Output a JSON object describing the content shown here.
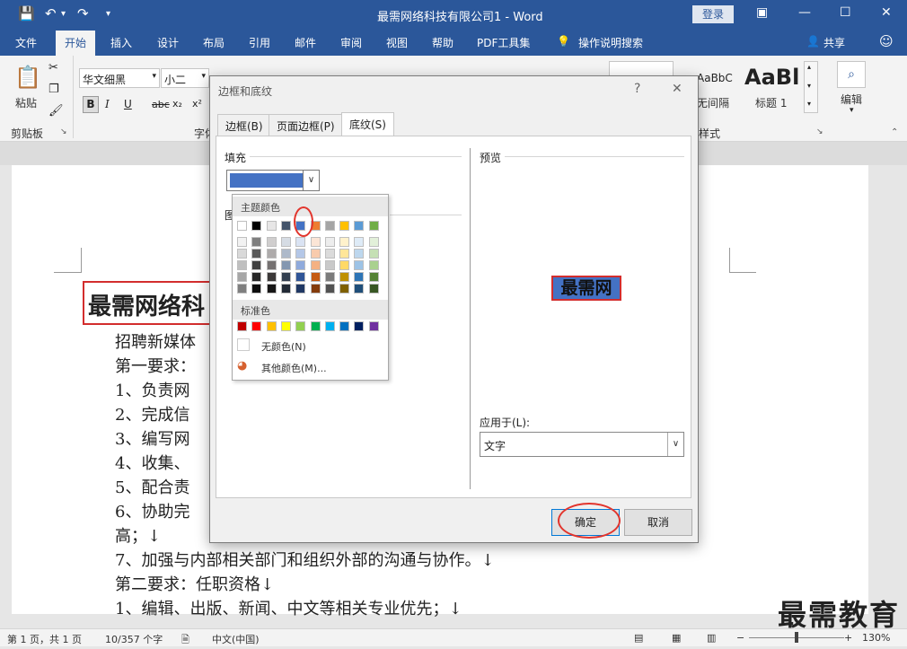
{
  "app": {
    "window_title": "最需网络科技有限公司1 - Word",
    "login_label": "登录"
  },
  "ribbon_tabs": [
    "文件",
    "开始",
    "插入",
    "设计",
    "布局",
    "引用",
    "邮件",
    "审阅",
    "视图",
    "帮助",
    "PDF工具集",
    "操作说明搜索"
  ],
  "ribbon": {
    "share_label": "共享",
    "paste_label": "粘贴",
    "clipboard_label": "剪贴板",
    "font_name": "华文细黑",
    "font_size": "小二",
    "font_group_label": "字体",
    "style_group_label": "样式",
    "style1_preview": "AaBbCcDc",
    "style1_label": "无间隔",
    "style2_preview": "AaBl",
    "style2_label": "标题 1",
    "edit_label": "编辑",
    "bold": "B",
    "italic": "I",
    "underline": "U",
    "strike": "abc",
    "subscript": "x₂",
    "superscript": "x²"
  },
  "document": {
    "title_visible": "最需网络科",
    "lines": [
      "招聘新媒体",
      "第一要求：",
      "1、负责网",
      "2、完成信",
      "3、编写网",
      "4、收集、",
      "5、配合责",
      "6、协助完",
      "高；↓",
      "7、加强与内部相关部门和组织外部的沟通与协作。↓",
      "第二要求：任职资格↓",
      "1、编辑、出版、新闻、中文等相关专业优先；↓"
    ]
  },
  "dialog": {
    "title": "边框和底纹",
    "help": "?",
    "close": "✕",
    "tabs": [
      "边框(B)",
      "页面边框(P)",
      "底纹(S)"
    ],
    "fill_label": "填充",
    "pattern_label": "图",
    "fill_color": "#4472c4",
    "palette": {
      "theme_header": "主题颜色",
      "standard_header": "标准色",
      "no_color": "无颜色(N)",
      "more_colors": "其他颜色(M)..."
    },
    "preview_label": "预览",
    "preview_text": "最需网",
    "apply_to_label": "应用于(L):",
    "apply_to_value": "文字",
    "ok": "确定",
    "cancel": "取消"
  },
  "theme_colors": [
    "#ffffff",
    "#000000",
    "#e7e6e6",
    "#44546a",
    "#4472c4",
    "#ed7d31",
    "#a5a5a5",
    "#ffc000",
    "#5b9bd5",
    "#70ad47"
  ],
  "theme_tints": [
    [
      "#f2f2f2",
      "#7f7f7f",
      "#d0cece",
      "#d6dce4",
      "#dae3f3",
      "#fbe5d6",
      "#ededed",
      "#fff2cc",
      "#deebf7",
      "#e2f0d9"
    ],
    [
      "#d9d9d9",
      "#595959",
      "#aeabab",
      "#adb9ca",
      "#b4c7e7",
      "#f8cbad",
      "#dbdbdb",
      "#ffe699",
      "#bdd7ee",
      "#c5e0b4"
    ],
    [
      "#bfbfbf",
      "#404040",
      "#757171",
      "#8497b0",
      "#8faadc",
      "#f4b183",
      "#c9c9c9",
      "#ffd966",
      "#9dc3e6",
      "#a9d18e"
    ],
    [
      "#a6a6a6",
      "#262626",
      "#3b3838",
      "#333f50",
      "#2f5597",
      "#c55a11",
      "#7b7b7b",
      "#bf9000",
      "#2e75b6",
      "#548235"
    ],
    [
      "#7f7f7f",
      "#0d0d0d",
      "#171616",
      "#222a35",
      "#203864",
      "#843c0c",
      "#525252",
      "#7f6000",
      "#1f4e79",
      "#385723"
    ]
  ],
  "standard_colors": [
    "#c00000",
    "#ff0000",
    "#ffc000",
    "#ffff00",
    "#92d050",
    "#00b050",
    "#00b0f0",
    "#0070c0",
    "#002060",
    "#7030a0"
  ],
  "statusbar": {
    "page": "第 1 页，共 1 页",
    "words": "10/357 个字",
    "language": "中文(中国)",
    "zoom": "130%"
  },
  "watermark": "最需教育"
}
